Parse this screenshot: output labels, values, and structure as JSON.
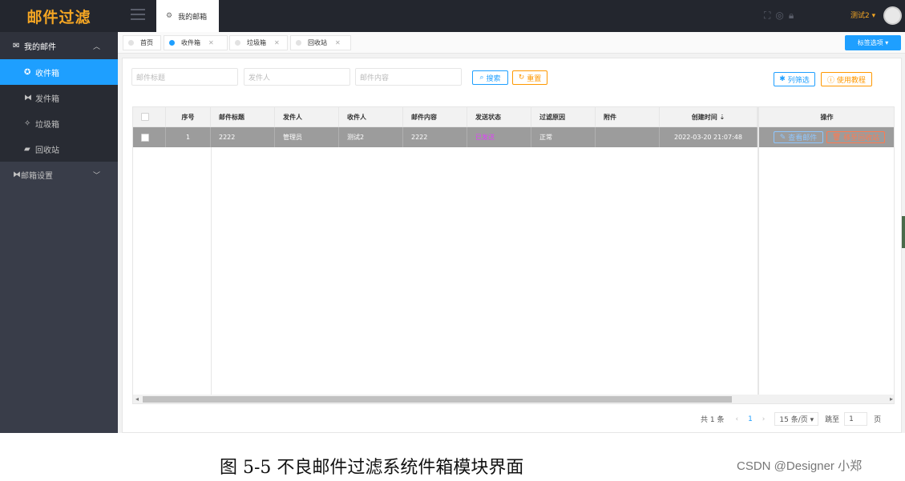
{
  "app": {
    "logo": "邮件过滤"
  },
  "sidebar": {
    "group_mail": "我的邮件",
    "items": [
      {
        "label": "收件箱",
        "active": true
      },
      {
        "label": "发件箱",
        "active": false
      },
      {
        "label": "垃圾箱",
        "active": false
      },
      {
        "label": "回收站",
        "active": false
      }
    ],
    "group_settings": "邮箱设置"
  },
  "header": {
    "tab": "我的邮箱",
    "user": "测试2 ▾"
  },
  "tabs": [
    {
      "label": "首页",
      "closable": false
    },
    {
      "label": "收件箱",
      "closable": true,
      "active": true
    },
    {
      "label": "垃圾箱",
      "closable": true
    },
    {
      "label": "回收站",
      "closable": true
    }
  ],
  "tab_options": "标签选项 ▾",
  "search": {
    "title_placeholder": "邮件标题",
    "sender_placeholder": "发件人",
    "content_placeholder": "邮件内容",
    "search_btn": "搜索",
    "reset_btn": "重置",
    "filter_btn": "列筛选",
    "tutorial_btn": "使用教程"
  },
  "table": {
    "headers": [
      "序号",
      "邮件标题",
      "发件人",
      "收件人",
      "邮件内容",
      "发送状态",
      "过滤原因",
      "附件",
      "创建时间 ⇣",
      "操作"
    ],
    "rows": [
      {
        "index": "1",
        "title": "2222",
        "sender": "管理员",
        "receiver": "测试2",
        "content": "2222",
        "status": "已发送",
        "reason": "正常",
        "attachment": "",
        "created": "2022-03-20 21:07:48",
        "view_btn": "查看邮件",
        "recycle_btn": "移至回收站"
      }
    ]
  },
  "pager": {
    "total": "共 1 条",
    "page": "1",
    "per_page": "15 条/页 ▾",
    "goto": "跳至",
    "goto_value": "1",
    "page_unit": "页"
  },
  "caption": "图 5-5  不良邮件过滤系统件箱模块界面",
  "watermark": "CSDN @Designer 小郑",
  "colors": {
    "accent": "#1e9fff",
    "sidebar": "#393d49",
    "header": "#23262e",
    "logo": "#f5a623",
    "danger": "#ff5722"
  }
}
